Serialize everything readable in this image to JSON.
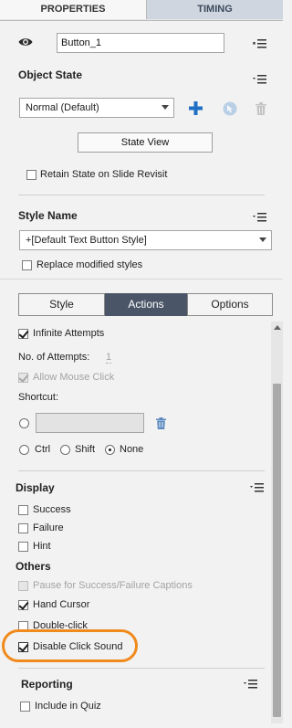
{
  "tabs": [
    {
      "label": "PROPERTIES"
    },
    {
      "label": "TIMING"
    }
  ],
  "object": {
    "name": "Button_1"
  },
  "object_state": {
    "title": "Object State",
    "state_value": "Normal (Default)",
    "state_view_label": "State View",
    "retain_label": "Retain State on Slide Revisit"
  },
  "style": {
    "title": "Style Name",
    "value": "+[Default Text Button Style]",
    "replace_label": "Replace modified styles"
  },
  "segments": {
    "style": "Style",
    "actions": "Actions",
    "options": "Options"
  },
  "actions": {
    "infinite_label": "Infinite Attempts",
    "attempts_label": "No. of Attempts:",
    "attempts_value": "1",
    "allow_mouse_label": "Allow Mouse Click",
    "shortcut_label": "Shortcut:",
    "shortcut_value": "",
    "ctrl_label": "Ctrl",
    "shift_label": "Shift",
    "none_label": "None"
  },
  "display": {
    "title": "Display",
    "success_label": "Success",
    "failure_label": "Failure",
    "hint_label": "Hint"
  },
  "others": {
    "title": "Others",
    "pause_label": "Pause for Success/Failure Captions",
    "hand_cursor_label": "Hand Cursor",
    "double_click_label": "Double-click",
    "disable_sound_label": "Disable Click Sound"
  },
  "reporting": {
    "title": "Reporting",
    "include_quiz_label": "Include in Quiz"
  },
  "colors": {
    "accent_blue": "#1f6fc5",
    "active_segment": "#4a5668",
    "highlight_orange": "#f08a1c"
  }
}
